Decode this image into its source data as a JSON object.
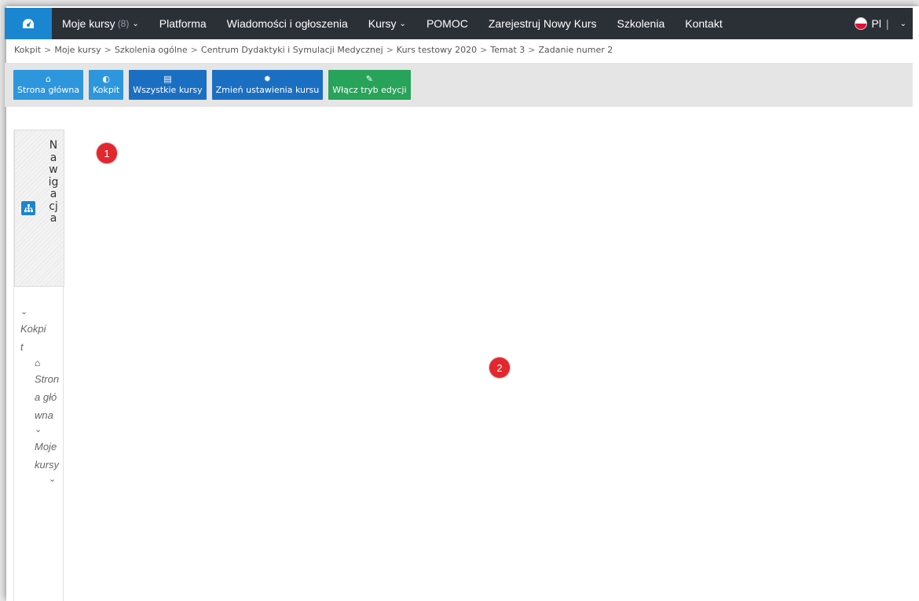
{
  "topbar": {
    "home_icon": "dashboard-icon",
    "items": [
      {
        "label": "Moje kursy",
        "count": "(8)",
        "dropdown": true
      },
      {
        "label": "Platforma",
        "dropdown": false
      },
      {
        "label": "Wiadomości i ogłoszenia",
        "dropdown": false
      },
      {
        "label": "Kursy",
        "dropdown": true
      },
      {
        "label": "POMOC",
        "dropdown": false
      },
      {
        "label": "Zarejestruj Nowy Kurs",
        "dropdown": false
      },
      {
        "label": "Szkolenia",
        "dropdown": false
      },
      {
        "label": "Kontakt",
        "dropdown": false
      }
    ],
    "language": "Pl",
    "background": "#2b2f36",
    "accent": "#1a86d1"
  },
  "breadcrumb": [
    "Kokpit",
    "Moje kursy",
    "Szkolenia ogólne",
    "Centrum Dydaktyki i Symulacji Medycznej",
    "Kurs testowy 2020",
    "Temat 3",
    "Zadanie numer 2"
  ],
  "toolbar": {
    "buttons": [
      {
        "label": "Strona główna",
        "icon": "home-icon",
        "color": "#2d96dc"
      },
      {
        "label": "Kokpit",
        "icon": "dashboard-icon",
        "color": "#2d96dc"
      },
      {
        "label": "Wszystkie kursy",
        "icon": "book-icon",
        "color": "#1b6fc2"
      },
      {
        "label": "Zmień ustawienia kursu",
        "icon": "gear-icon",
        "color": "#1b6fc2"
      },
      {
        "label": "Włącz tryb edycji",
        "icon": "edit-icon",
        "color": "#27a35a"
      }
    ]
  },
  "navigation": {
    "title": "Nawigacja",
    "icon": "sitemap-icon",
    "tree": {
      "root": "Kokpit",
      "home": "Strona główna",
      "my_courses": "Moje kursy"
    }
  },
  "markers": {
    "one": "1",
    "two": "2"
  }
}
